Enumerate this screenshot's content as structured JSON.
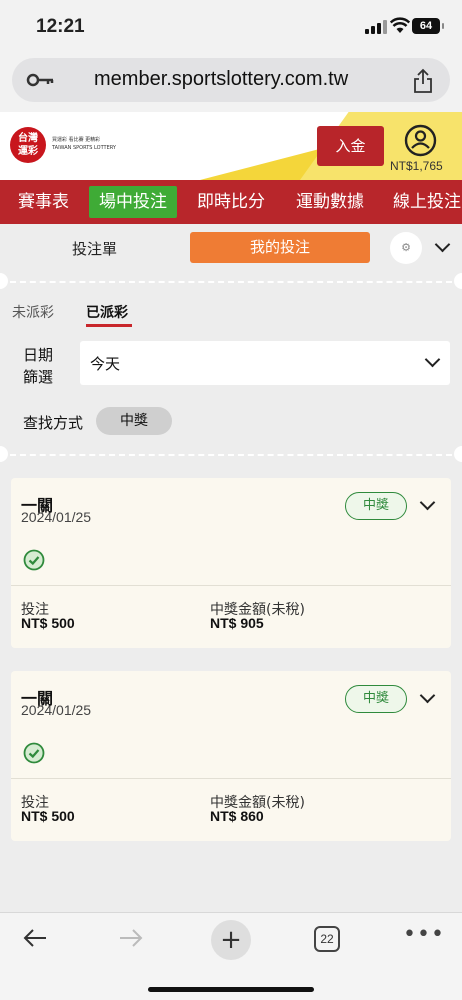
{
  "status": {
    "time": "12:21",
    "battery": "64"
  },
  "browser": {
    "url": "member.sportslottery.com.tw",
    "tab_count": "22"
  },
  "site": {
    "logo_line1": "台灣",
    "logo_line2": "運彩",
    "logo_sub": "買運彩 看比賽 更精彩",
    "logo_en": "TAIWAN SPORTS LOTTERY",
    "deposit_label": "入金",
    "balance": "NT$1,765"
  },
  "nav": {
    "items": [
      {
        "label": "賽事表"
      },
      {
        "label": "場中投注"
      },
      {
        "label": "即時比分"
      },
      {
        "label": "運動數據"
      },
      {
        "label": "線上投注"
      }
    ]
  },
  "tabs": {
    "bet_slip": "投注單",
    "my_bets": "我的投注"
  },
  "subtabs": {
    "unsettled": "未派彩",
    "settled": "已派彩"
  },
  "filters": {
    "date_label_1": "日期",
    "date_label_2": "篩選",
    "date_value": "今天",
    "search_label": "查找方式",
    "search_chip": "中獎"
  },
  "bets": [
    {
      "type": "一關",
      "date": "2024/01/25",
      "status": "中獎",
      "stake_label": "投注",
      "stake": "NT$ 500",
      "winnings_label": "中獎金額(未稅)",
      "winnings": "NT$ 905"
    },
    {
      "type": "一關",
      "date": "2024/01/25",
      "status": "中獎",
      "stake_label": "投注",
      "stake": "NT$ 500",
      "winnings_label": "中獎金額(未稅)",
      "winnings": "NT$ 860"
    }
  ],
  "colors": {
    "brand_red": "#b8262b",
    "nav_active": "#3fab36",
    "my_bets_orange": "#ef7c34",
    "win_green": "#2f8a3c"
  }
}
